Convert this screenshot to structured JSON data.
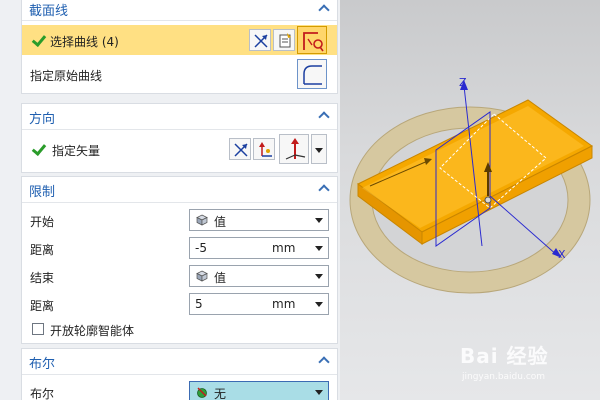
{
  "sections": {
    "section_curve": {
      "title": "截面线"
    },
    "section_direction": {
      "title": "方向"
    },
    "section_limits": {
      "title": "限制"
    },
    "section_boolean": {
      "title": "布尔"
    }
  },
  "curve": {
    "select_curve_label": "选择曲线 (4)",
    "specify_original_label": "指定原始曲线"
  },
  "direction": {
    "specify_vector_label": "指定矢量"
  },
  "limits": {
    "start_label": "开始",
    "start_value": "值",
    "distance1_label": "距离",
    "distance1_value": "-5",
    "distance1_unit": "mm",
    "end_label": "结束",
    "end_value": "值",
    "distance2_label": "距离",
    "distance2_value": "5",
    "distance2_unit": "mm",
    "open_profile_label": "开放轮廓智能体"
  },
  "boolean": {
    "boolean_label": "布尔",
    "boolean_value": "无"
  },
  "viewport": {
    "axis_z": "Z",
    "axis_x": "X",
    "watermark": "Bai 经验",
    "watermark_url": "jingyan.baidu.com"
  },
  "colors": {
    "highlight": "#ffe083",
    "section_title": "#1f5fb0",
    "plate": "#f7a900",
    "ring": "#d6c8a0",
    "boolean_field": "#a9dde6"
  },
  "icons": [
    "check-icon",
    "curve-select-icon",
    "reverse-direction-icon",
    "vector-dialog-icon",
    "corner-curve-icon",
    "vector-constructor-icon",
    "cube-icon",
    "dropdown-arrow-icon",
    "boolean-icon"
  ]
}
